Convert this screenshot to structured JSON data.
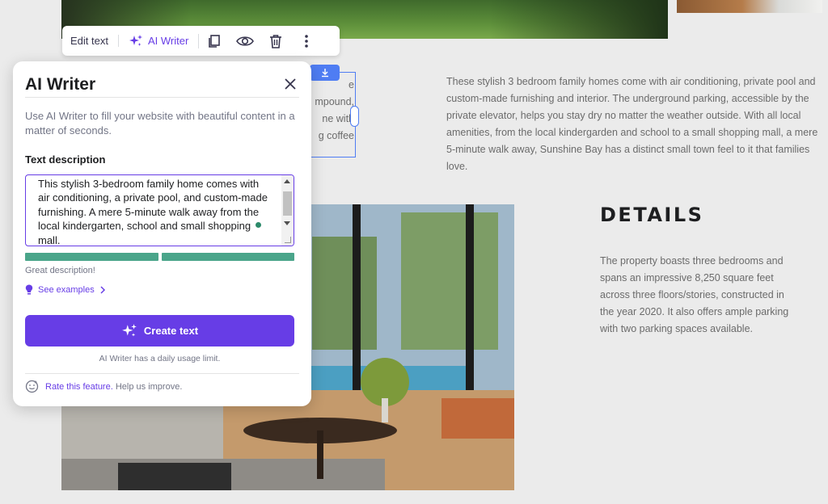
{
  "toolbar": {
    "edit_text": "Edit text",
    "ai_writer": "AI Writer"
  },
  "site": {
    "paragraph_right": "These stylish 3 bedroom family homes come with air conditioning, private pool and custom-made furnishing and interior. The underground parking, accessible by the private elevator, helps you stay dry no matter the weather outside. With all local amenities, from the local kindergarden and school to a small shopping mall, a mere 5-minute walk away, Sunshine Bay has a distinct small town feel to it that families love.",
    "selected_fragment": "e\nmpound,\nne with\ng coffee",
    "details_title": "DETAILS",
    "details_text": "The property boasts three bedrooms and spans an impressive 8,250 square feet across three floors/stories, constructed in the year 2020. It also offers ample parking with two parking spaces available."
  },
  "panel": {
    "title": "AI Writer",
    "description": "Use AI Writer to fill your website with beautiful content in a matter of seconds.",
    "text_label": "Text description",
    "text_value": "This stylish 3-bedroom family home comes with air conditioning, a private pool, and custom-made furnishing. A mere 5-minute walk away from the local kindergarten, school and small shopping mall.",
    "quality": "Great description!",
    "see_examples": "See examples",
    "create_button": "Create text",
    "limit_note": "AI Writer has a daily usage limit.",
    "rate_link": "Rate this feature.",
    "rate_suffix": " Help us improve."
  },
  "colors": {
    "accent": "#673de6",
    "selection": "#4f7df3",
    "quality_bar": "#4aa58a"
  }
}
